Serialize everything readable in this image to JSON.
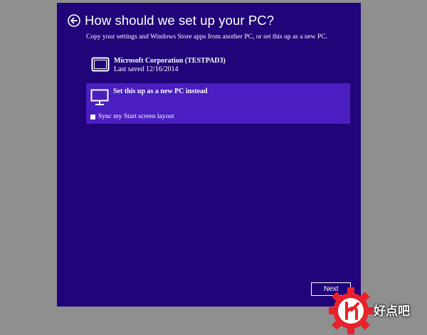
{
  "window": {
    "title": "How should we set up your PC?",
    "subtitle": "Copy your settings and Windows Store apps from another PC, or set this up as a new PC."
  },
  "options": {
    "existing_pc": {
      "name": "Microsoft Corporation (TESTPAD3)",
      "last_saved": "Last saved 12/16/2014",
      "icon": "tablet-icon"
    },
    "new_pc": {
      "name": "Set this up as a new PC instead",
      "icon": "monitor-icon",
      "selected": true,
      "sync_label": "Sync my Start screen layout",
      "sync_checked": false
    }
  },
  "footer": {
    "next_label": "Next"
  },
  "watermark": {
    "text": "好点吧"
  },
  "colors": {
    "background": "#8f8f8f",
    "window": "#21047a",
    "selected_option": "#4a1ec0",
    "text": "#ffffff",
    "watermark_red": "#e8212b"
  }
}
